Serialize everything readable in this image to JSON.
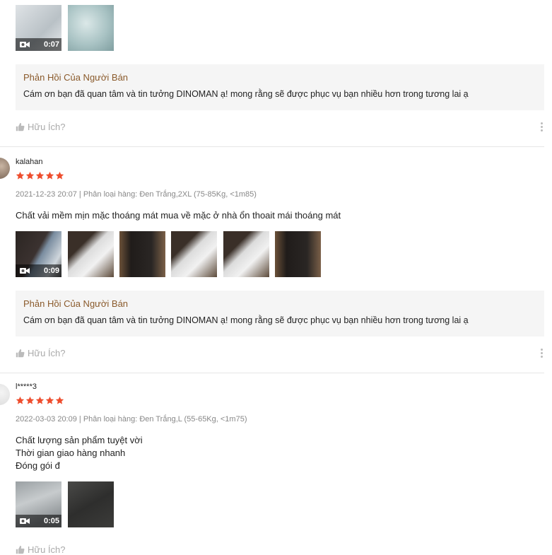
{
  "colors": {
    "star": "#ee4d2d",
    "seller_title": "#8a5a2b",
    "reply_bg": "#f5f5f5",
    "muted": "#888888"
  },
  "helpful_label": "Hữu Ích?",
  "seller_reply_title": "Phản Hồi Của Người Bán",
  "reviews": [
    {
      "media": [
        {
          "type": "video",
          "duration": "0:07"
        },
        {
          "type": "image"
        }
      ],
      "reply_text": "Cám ơn bạn đã quan tâm và tin tưởng DINOMAN ạ! mong rằng sẽ được phục vụ bạn nhiều hơn trong tương lai ạ"
    },
    {
      "username": "kalahan",
      "rating": 5,
      "meta": "2021-12-23 20:07 | Phân loại hàng: Đen Trắng,2XL (75-85Kg, <1m85)",
      "comment": "Chất vải mềm mịn mặc thoáng mát mua về mặc ở nhà ổn  thoait mái thoáng mát",
      "media": [
        {
          "type": "video",
          "duration": "0:09"
        },
        {
          "type": "image"
        },
        {
          "type": "image"
        },
        {
          "type": "image"
        },
        {
          "type": "image"
        },
        {
          "type": "image"
        }
      ],
      "reply_text": "Cám ơn bạn đã quan tâm và tin tưởng DINOMAN ạ! mong rằng sẽ được phục vụ bạn nhiều hơn trong tương lai ạ"
    },
    {
      "username": "l*****3",
      "rating": 5,
      "meta": "2022-03-03 20:09 | Phân loại hàng: Đen Trắng,L (55-65Kg, <1m75)",
      "comment_lines": [
        "Chất lượng sản phẩm tuyệt vời",
        "Thời gian giao hàng nhanh",
        "Đóng gói đ"
      ],
      "media": [
        {
          "type": "video",
          "duration": "0:05"
        },
        {
          "type": "image"
        }
      ]
    }
  ]
}
